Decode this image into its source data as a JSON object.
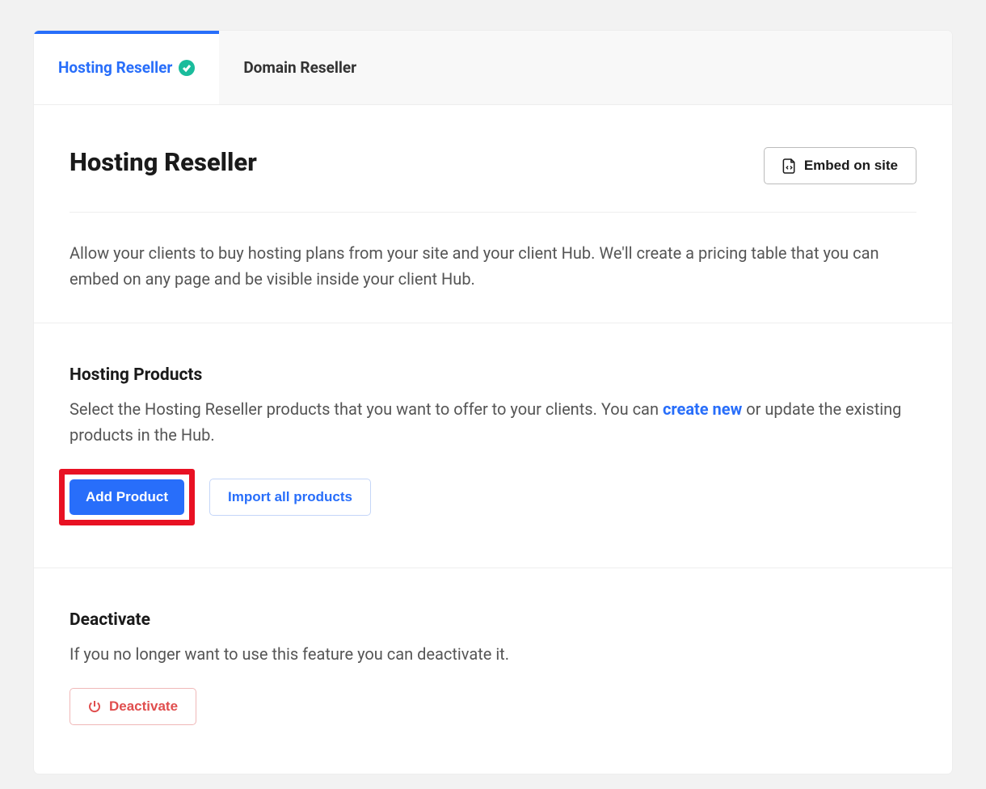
{
  "tabs": {
    "hosting": {
      "label": "Hosting Reseller"
    },
    "domain": {
      "label": "Domain Reseller"
    }
  },
  "header": {
    "title": "Hosting Reseller",
    "embed_button": "Embed on site",
    "description": "Allow your clients to buy hosting plans from your site and your client Hub. We'll create a pricing table that you can embed on any page and be visible inside your client Hub."
  },
  "products": {
    "title": "Hosting Products",
    "description_prefix": "Select the Hosting Reseller products that you want to offer to your clients. You can ",
    "create_new_link": "create new",
    "description_suffix": " or update the existing products in the Hub.",
    "add_button": "Add Product",
    "import_button": "Import all products"
  },
  "deactivate": {
    "title": "Deactivate",
    "description": "If you no longer want to use this feature you can deactivate it.",
    "button": "Deactivate"
  }
}
